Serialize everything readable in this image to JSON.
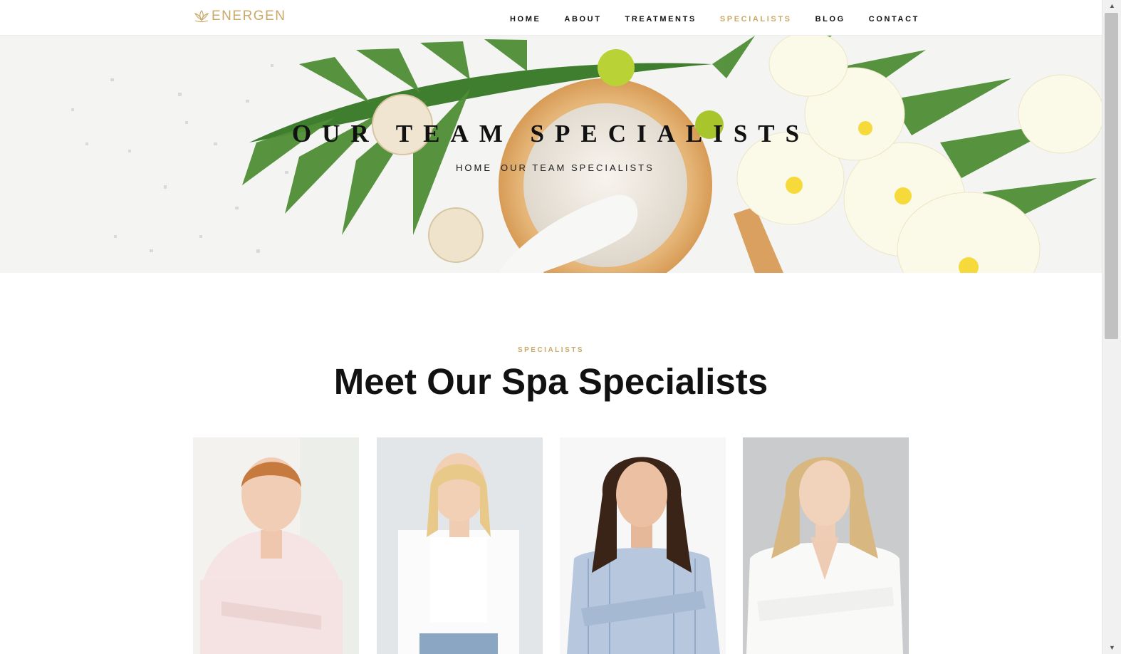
{
  "header": {
    "brand": "ENERGEN",
    "nav": [
      {
        "label": "HOME",
        "active": false
      },
      {
        "label": "ABOUT",
        "active": false
      },
      {
        "label": "TREATMENTS",
        "active": false
      },
      {
        "label": "SPECIALISTS",
        "active": true
      },
      {
        "label": "BLOG",
        "active": false
      },
      {
        "label": "CONTACT",
        "active": false
      }
    ]
  },
  "hero": {
    "title": "OUR TEAM SPECIALISTS",
    "breadcrumb": {
      "home": "HOME",
      "current": "OUR TEAM SPECIALISTS"
    }
  },
  "section": {
    "eyebrow": "SPECIALISTS",
    "title": "Meet Our Spa Specialists"
  },
  "team": [
    {
      "photo": "specialist-photo-1"
    },
    {
      "photo": "specialist-photo-2"
    },
    {
      "photo": "specialist-photo-3"
    },
    {
      "photo": "specialist-photo-4"
    }
  ],
  "colors": {
    "accent": "#c9a969",
    "text": "#111111",
    "background": "#ffffff"
  }
}
